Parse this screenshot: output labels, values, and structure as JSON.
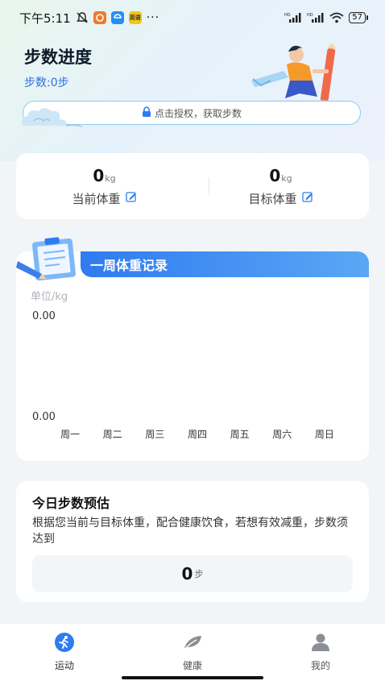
{
  "status_bar": {
    "time": "下午5:11",
    "app_badge_text": "英语",
    "network_1": "HD",
    "network_2": "HD",
    "battery": "57",
    "dots": "···"
  },
  "header": {
    "title": "步数进度",
    "steps_text": "步数:0步"
  },
  "auth": {
    "text": "点击授权，获取步数"
  },
  "weight": {
    "current_value": "0",
    "current_unit": "kg",
    "current_label": "当前体重",
    "target_value": "0",
    "target_unit": "kg",
    "target_label": "目标体重"
  },
  "weekly": {
    "title": "一周体重记录",
    "unit_label": "单位/kg",
    "y_top": "0.00",
    "y_bottom": "0.00",
    "days": [
      "周一",
      "周二",
      "周三",
      "周四",
      "周五",
      "周六",
      "周日"
    ]
  },
  "estimate": {
    "title": "今日步数预估",
    "description": "根据您当前与目标体重，配合健康饮食，若想有效减重，步数须达到",
    "value": "0",
    "unit": "步"
  },
  "tabs": [
    {
      "label": "运动",
      "icon": "running-icon",
      "active": true
    },
    {
      "label": "健康",
      "icon": "leaf-icon",
      "active": false
    },
    {
      "label": "我的",
      "icon": "user-icon",
      "active": false
    }
  ],
  "colors": {
    "accent": "#2f7bf0",
    "steps_text": "#2f6fe0",
    "auth_border": "#8ec9ee"
  }
}
